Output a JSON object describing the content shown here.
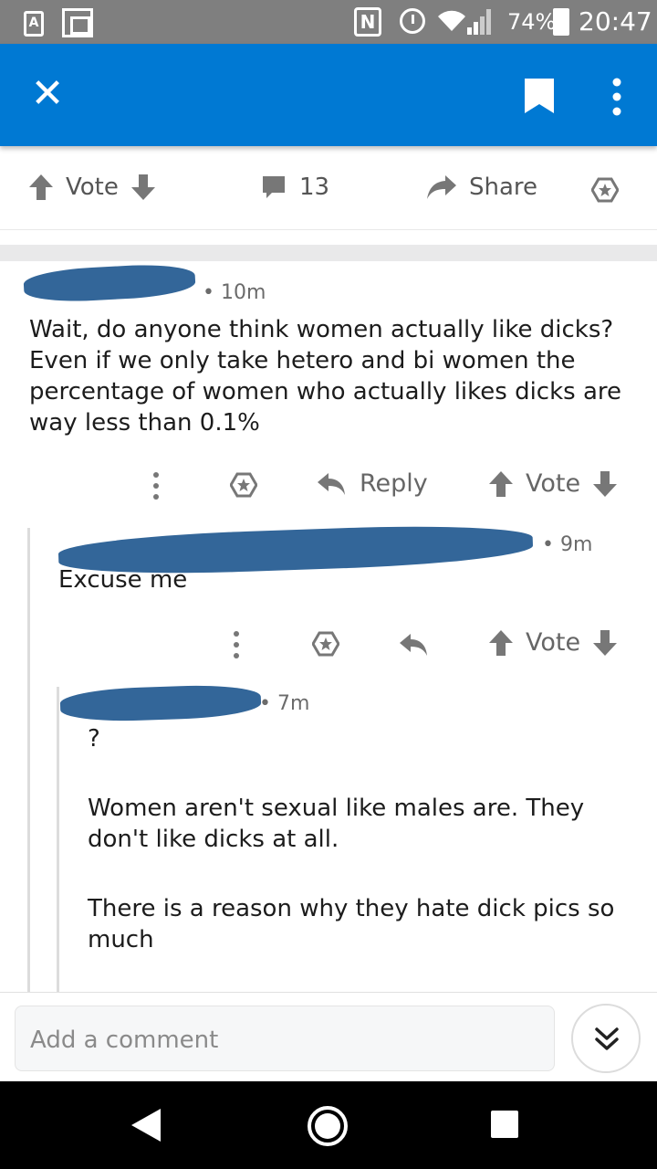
{
  "status_bar": {
    "battery": "74%",
    "time": "20:47",
    "nfc": "N",
    "left_icon": "A"
  },
  "post_actions": {
    "vote_label": "Vote",
    "comment_count": "13",
    "share_label": "Share"
  },
  "comments": [
    {
      "age": "10m",
      "body_lines": [
        "Wait, do anyone think women actually like dicks?",
        "Even if we only take hetero and bi women the",
        "percentage of women who actually likes dicks are",
        "way less than 0.1%"
      ],
      "reply_label": "Reply",
      "vote_label": "Vote"
    },
    {
      "age": "9m",
      "body_lines": [
        "Excuse me"
      ],
      "vote_label": "Vote"
    },
    {
      "age": "7m",
      "paragraphs": [
        "?",
        "Women aren't sexual like males are. They don't like dicks at all.",
        "There is a reason why they hate dick pics so much"
      ]
    }
  ],
  "comment_bar": {
    "placeholder": "Add a comment"
  },
  "separator": "•",
  "icons": [
    "close-icon",
    "bookmark-icon",
    "more-vertical-icon",
    "upvote-icon",
    "downvote-icon",
    "comment-icon",
    "share-icon",
    "award-icon",
    "reply-icon",
    "chevrons-down-icon",
    "back-icon",
    "home-icon",
    "recents-icon"
  ]
}
